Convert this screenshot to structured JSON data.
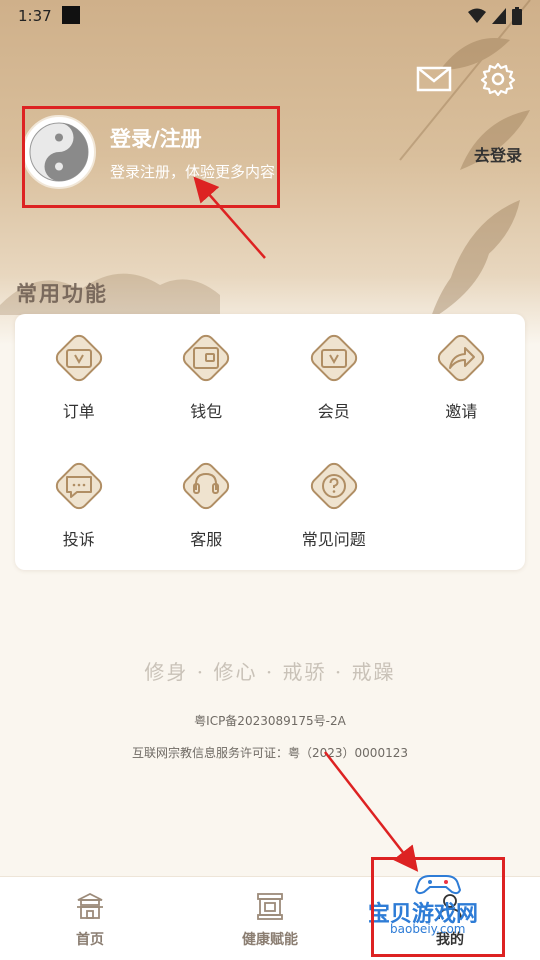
{
  "status_bar": {
    "time": "1:37"
  },
  "profile": {
    "name": "登录/注册",
    "hint": "登录注册，体验更多内容",
    "go_login": "去登录"
  },
  "section_title": "常用功能",
  "functions": [
    {
      "label": "订单",
      "icon": "ticket-v-icon"
    },
    {
      "label": "钱包",
      "icon": "wallet-icon"
    },
    {
      "label": "会员",
      "icon": "member-card-icon"
    },
    {
      "label": "邀请",
      "icon": "share-arrow-icon"
    },
    {
      "label": "投诉",
      "icon": "complaint-bubble-icon"
    },
    {
      "label": "客服",
      "icon": "headset-icon"
    },
    {
      "label": "常见问题",
      "icon": "question-icon"
    }
  ],
  "motto": "修身 · 修心 · 戒骄 · 戒躁",
  "icp": "粤ICP备2023089175号-2A",
  "license": "互联网宗教信息服务许可证：粤（2023）0000123",
  "tabs": [
    {
      "label": "首页",
      "icon": "temple-icon"
    },
    {
      "label": "健康赋能",
      "icon": "scroll-frame-icon"
    },
    {
      "label": "我的",
      "icon": "profile-icon"
    }
  ],
  "watermark": {
    "main": "宝贝游戏网",
    "sub": "baobeiy.com"
  },
  "colors": {
    "icon_bg": "#efe3cf",
    "icon_stroke": "#b08e64",
    "annotation": "#dd2222"
  }
}
